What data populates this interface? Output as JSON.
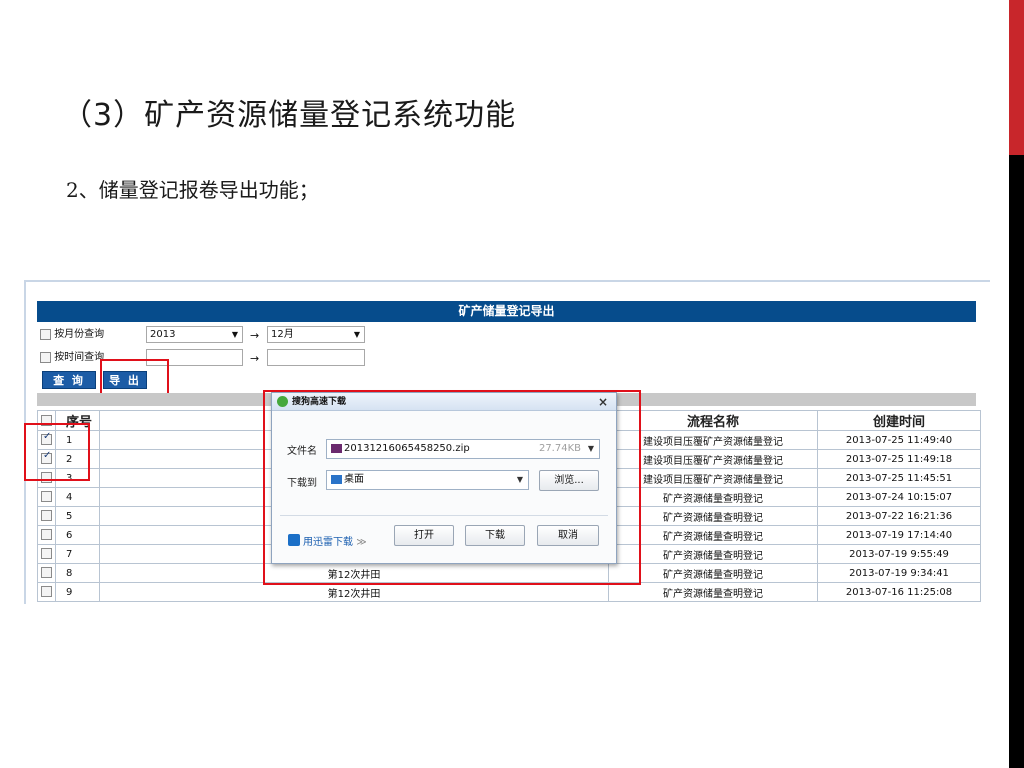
{
  "slide": {
    "title": "（3）矿产资源储量登记系统功能",
    "subtitle": "2、储量登记报卷导出功能；"
  },
  "panel": {
    "title": "矿产储量登记导出",
    "filter_month_label": "按月份查询",
    "year_value": "2013",
    "month_value": "12月",
    "arrow": "→",
    "filter_time_label": "按时间查询",
    "query_button": "查 询",
    "export_button": "导 出"
  },
  "table": {
    "headers": [
      "序号",
      "流程名称",
      "创建时间"
    ],
    "rows": [
      {
        "num": "1",
        "name": "",
        "process": "建设项目压覆矿产资源储量登记",
        "time": "2013-07-25 11:49:40",
        "checked": true
      },
      {
        "num": "2",
        "name": "",
        "process": "建设项目压覆矿产资源储量登记",
        "time": "2013-07-25 11:49:18",
        "checked": true
      },
      {
        "num": "3",
        "name": "",
        "process": "建设项目压覆矿产资源储量登记",
        "time": "2013-07-25 11:45:51",
        "checked": false
      },
      {
        "num": "4",
        "name": "",
        "process": "矿产资源储量查明登记",
        "time": "2013-07-24 10:15:07",
        "checked": false
      },
      {
        "num": "5",
        "name": "",
        "process": "矿产资源储量查明登记",
        "time": "2013-07-22 16:21:36",
        "checked": false
      },
      {
        "num": "6",
        "name": "",
        "process": "矿产资源储量查明登记",
        "time": "2013-07-19 17:14:40",
        "checked": false
      },
      {
        "num": "7",
        "name": "",
        "process": "矿产资源储量查明登记",
        "time": "2013-07-19 9:55:49",
        "checked": false
      },
      {
        "num": "8",
        "name": "第12次井田",
        "process": "矿产资源储量查明登记",
        "time": "2013-07-19 9:34:41",
        "checked": false
      },
      {
        "num": "9",
        "name": "第12次井田",
        "process": "矿产资源储量查明登记",
        "time": "2013-07-16 11:25:08",
        "checked": false
      }
    ]
  },
  "dialog": {
    "title": "搜狗高速下载",
    "close": "×",
    "filename_label": "文件名",
    "filename_value": "20131216065458250.zip",
    "file_size": "27.74KB",
    "saveto_label": "下载到",
    "saveto_value": "桌面",
    "browse_button": "浏览...",
    "thunder_link": "用迅雷下载",
    "thunder_chevron": "≫",
    "open_button": "打开",
    "download_button": "下载",
    "cancel_button": "取消"
  },
  "colors": {
    "header_blue": "#064c8c",
    "button_blue": "#1c5ca6",
    "highlight_red": "#e0101a",
    "side_red": "#c8262b"
  }
}
